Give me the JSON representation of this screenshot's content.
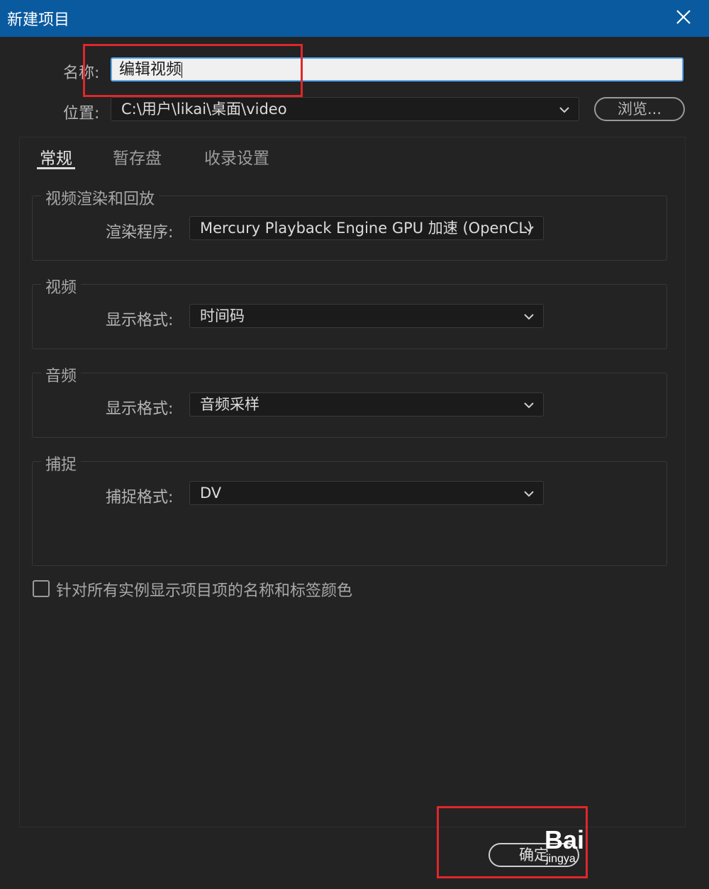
{
  "window": {
    "title": "新建项目"
  },
  "form": {
    "name_label": "名称:",
    "name_value": "编辑视频",
    "location_label": "位置:",
    "location_value": "C:\\用户\\likai\\桌面\\video",
    "browse_label": "浏览..."
  },
  "tabs": [
    {
      "label": "常规",
      "active": true
    },
    {
      "label": "暂存盘",
      "active": false
    },
    {
      "label": "收录设置",
      "active": false
    }
  ],
  "groups": {
    "render": {
      "title": "视频渲染和回放",
      "field_label": "渲染程序:",
      "value": "Mercury Playback Engine GPU 加速 (OpenCL)"
    },
    "video": {
      "title": "视频",
      "field_label": "显示格式:",
      "value": "时间码"
    },
    "audio": {
      "title": "音频",
      "field_label": "显示格式:",
      "value": "音频采样"
    },
    "capture": {
      "title": "捕捉",
      "field_label": "捕捉格式:",
      "value": "DV"
    }
  },
  "checkbox": {
    "label": "针对所有实例显示项目项的名称和标签颜色",
    "checked": false
  },
  "buttons": {
    "ok_label": "确定"
  },
  "watermark": {
    "brand": "Bai",
    "sub": "jingya"
  },
  "colors": {
    "titlebar": "#0a5aa0",
    "background": "#232323",
    "highlight": "#e0262a",
    "input_focus": "#5aa8f0"
  },
  "icons": {
    "close": "close-icon",
    "dropdown": "chevron-down-icon"
  }
}
